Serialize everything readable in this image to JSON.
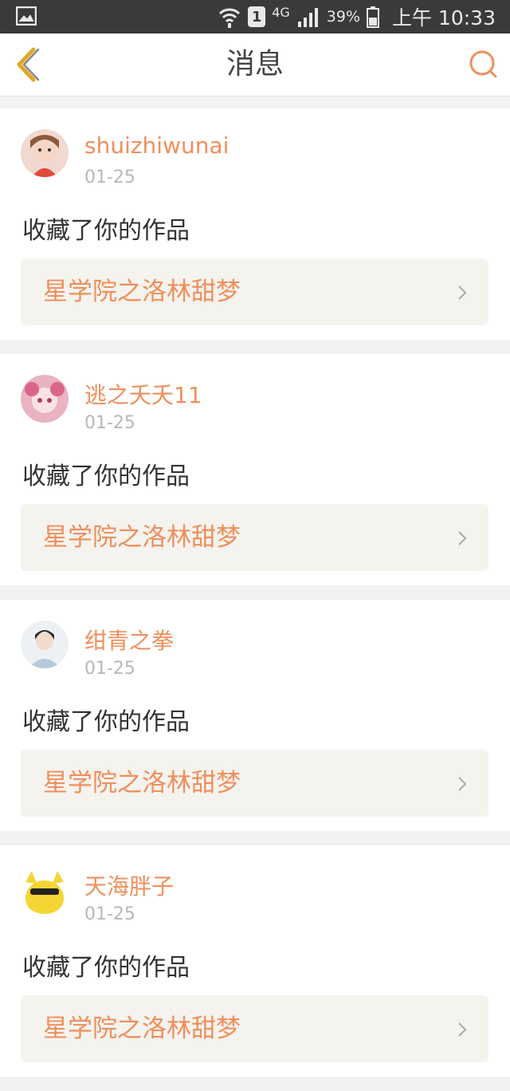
{
  "status_bar": {
    "sim_number": "1",
    "network": "4G",
    "battery": "39%",
    "time": "上午 10:33"
  },
  "nav": {
    "title": "消息"
  },
  "messages": [
    {
      "username": "shuizhiwunai",
      "date": "01-25",
      "action": "收藏了你的作品",
      "work_title": "星学院之洛林甜梦"
    },
    {
      "username": "逃之夭夭11",
      "date": "01-25",
      "action": "收藏了你的作品",
      "work_title": "星学院之洛林甜梦"
    },
    {
      "username": "绀青之拳",
      "date": "01-25",
      "action": "收藏了你的作品",
      "work_title": "星学院之洛林甜梦"
    },
    {
      "username": "天海胖子",
      "date": "01-25",
      "action": "收藏了你的作品",
      "work_title": "星学院之洛林甜梦"
    }
  ],
  "colors": {
    "accent": "#ef8f5c",
    "back_icon": "#e0a82a",
    "status_bar_bg": "#3a3a3a"
  }
}
